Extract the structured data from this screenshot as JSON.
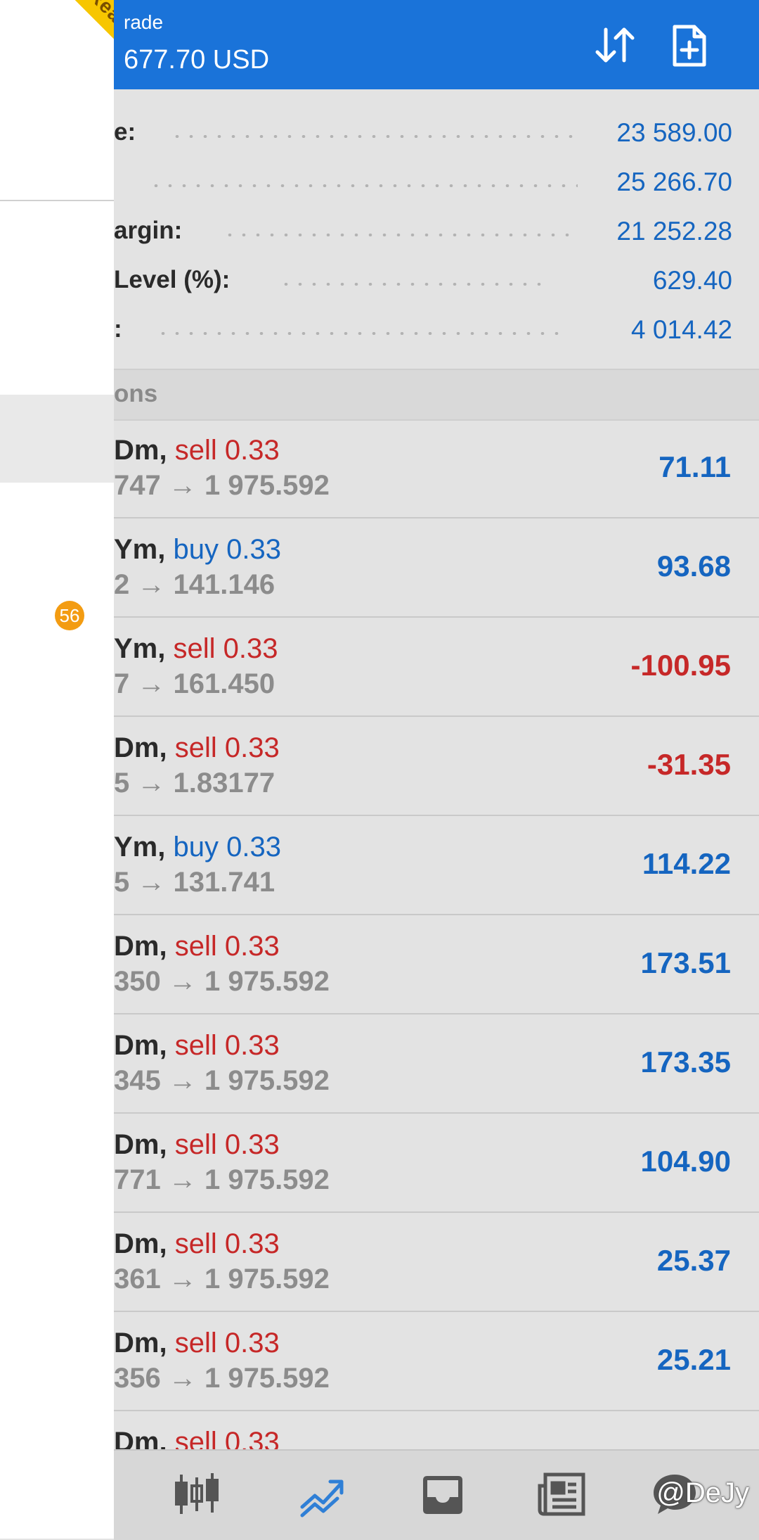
{
  "drawer": {
    "ribbon": "Real",
    "badge": "56"
  },
  "header": {
    "title": "rade",
    "balance": "677.70 USD",
    "sort_icon": "sort-arrows-icon",
    "new_order_icon": "new-order-icon"
  },
  "summary": [
    {
      "label": "e:",
      "value": "23 589.00"
    },
    {
      "label": "",
      "value": "25 266.70"
    },
    {
      "label": "argin:",
      "value": "21 252.28"
    },
    {
      "label": " Level (%):",
      "value": "629.40"
    },
    {
      "label": ":",
      "value": "4 014.42"
    }
  ],
  "section": {
    "title": "ons"
  },
  "positions": [
    {
      "symbol": "Dm,",
      "side": "sell",
      "lot": "0.33",
      "prices": "747 → 1 975.592",
      "profit": "71.11",
      "negative": false
    },
    {
      "symbol": "Ym,",
      "side": "buy",
      "lot": "0.33",
      "prices": "2 → 141.146",
      "profit": "93.68",
      "negative": false
    },
    {
      "symbol": "Ym,",
      "side": "sell",
      "lot": "0.33",
      "prices": "7 → 161.450",
      "profit": "-100.95",
      "negative": true
    },
    {
      "symbol": "Dm,",
      "side": "sell",
      "lot": "0.33",
      "prices": "5 → 1.83177",
      "profit": "-31.35",
      "negative": true
    },
    {
      "symbol": "Ym,",
      "side": "buy",
      "lot": "0.33",
      "prices": "5 → 131.741",
      "profit": "114.22",
      "negative": false
    },
    {
      "symbol": "Dm,",
      "side": "sell",
      "lot": "0.33",
      "prices": "350 → 1 975.592",
      "profit": "173.51",
      "negative": false
    },
    {
      "symbol": "Dm,",
      "side": "sell",
      "lot": "0.33",
      "prices": "345 → 1 975.592",
      "profit": "173.35",
      "negative": false
    },
    {
      "symbol": "Dm,",
      "side": "sell",
      "lot": "0.33",
      "prices": "771 → 1 975.592",
      "profit": "104.90",
      "negative": false
    },
    {
      "symbol": "Dm,",
      "side": "sell",
      "lot": "0.33",
      "prices": "361 → 1 975.592",
      "profit": "25.37",
      "negative": false
    },
    {
      "symbol": "Dm,",
      "side": "sell",
      "lot": "0.33",
      "prices": "356 → 1 975.592",
      "profit": "25.21",
      "negative": false
    },
    {
      "symbol": "Dm,",
      "side": "sell",
      "lot": "0.33",
      "prices": "",
      "profit": "",
      "negative": false
    }
  ],
  "bottom_nav": [
    {
      "name": "quotes",
      "icon": "candlestick-icon",
      "active": false
    },
    {
      "name": "trade",
      "icon": "trend-chart-icon",
      "active": true
    },
    {
      "name": "history",
      "icon": "inbox-icon",
      "active": false
    },
    {
      "name": "news",
      "icon": "newspaper-icon",
      "active": false
    },
    {
      "name": "chat",
      "icon": "chat-icon",
      "active": false
    }
  ],
  "watermark": "@DeJy",
  "colors": {
    "header": "#1a73d9",
    "positive": "#1565c0",
    "negative": "#c62828",
    "ribbon": "#f7c600",
    "badge": "#f39c12",
    "active_nav": "#2f7fd6"
  }
}
